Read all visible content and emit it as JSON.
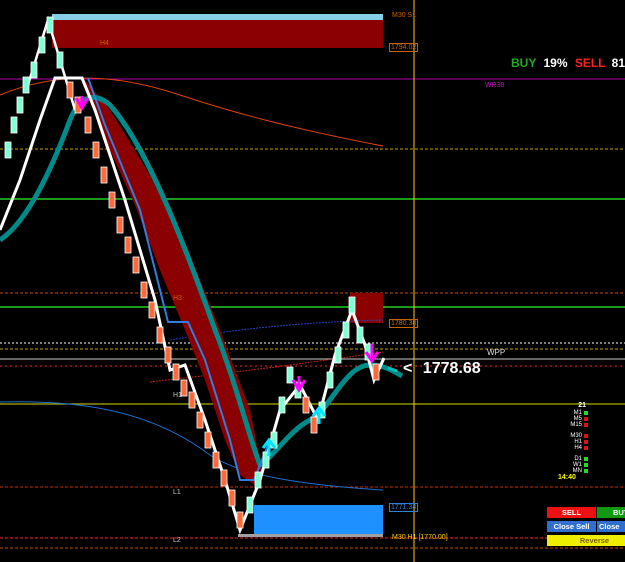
{
  "sentiment": {
    "buy_label": "BUY",
    "buy_pct": "19%",
    "sell_label": "SELL",
    "sell_pct": "81"
  },
  "price": {
    "arrow": "<",
    "value": "1778.68"
  },
  "levels": {
    "m30_top": "M30 S1",
    "h4": "H4",
    "h4_box_price": "1794.02",
    "wr": "WR38",
    "h3": "H3",
    "h3_box_price": "1780.38",
    "wpp": "WPP",
    "h1": "H1",
    "l1": "L1",
    "l1_box_price": "1771.34",
    "l2": "L2",
    "m30_bottom": "M30 H1 [1770.00]"
  },
  "timeframes": {
    "count": "21",
    "items": [
      {
        "label": "M1",
        "color": "#22dd22"
      },
      {
        "label": "M5",
        "color": "#dd1111"
      },
      {
        "label": "M15",
        "color": "#dd1111"
      },
      {
        "label": "M30",
        "color": "#dd1111"
      },
      {
        "label": "H1",
        "color": "#dd1111"
      },
      {
        "label": "H4",
        "color": "#dd1111"
      },
      {
        "label": "D1",
        "color": "#22dd22"
      },
      {
        "label": "W1",
        "color": "#22dd22"
      },
      {
        "label": "MN",
        "color": "#22dd22"
      }
    ],
    "time": "14:40"
  },
  "buttons": {
    "sell": "SELL",
    "buy": "BUY",
    "close_sell": "Close Sell",
    "close_buy": "Close",
    "reverse": "Reverse"
  },
  "colors": {
    "buy": "#22aa22",
    "sell": "#ff2222",
    "background": "#000000",
    "zone_red": "#8b0000",
    "zone_blue": "#1e90ff",
    "teal_band": "#008b8b",
    "up_arrow": "#00e5ff",
    "down_arrow": "#ff00ff"
  }
}
